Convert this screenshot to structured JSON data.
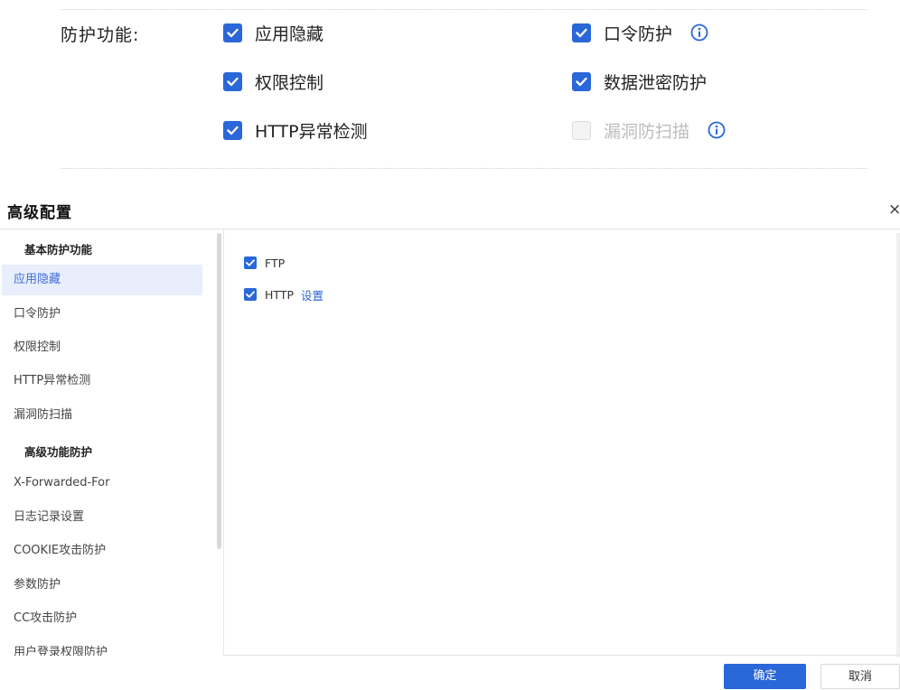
{
  "protection": {
    "label": "防护功能:",
    "options": [
      {
        "label": "应用隐藏",
        "checked": true
      },
      {
        "label": "口令防护",
        "checked": true
      },
      {
        "label": "权限控制",
        "checked": true
      },
      {
        "label": "数据泄密防护",
        "checked": true
      },
      {
        "label": "HTTP异常检测",
        "checked": true
      },
      {
        "label": "漏洞防扫描",
        "checked": false
      }
    ]
  },
  "modal": {
    "title": "高级配置",
    "close_icon": "×",
    "groups": [
      {
        "title": "基本防护功能"
      },
      {
        "title": "高级功能防护"
      }
    ],
    "nav": [
      {
        "label": "应用隐藏",
        "active": true
      },
      {
        "label": "口令防护"
      },
      {
        "label": "权限控制"
      },
      {
        "label": "HTTP异常检测"
      },
      {
        "label": "漏洞防扫描"
      },
      {
        "label": "X-Forwarded-For"
      },
      {
        "label": "日志记录设置"
      },
      {
        "label": "COOKIE攻击防护"
      },
      {
        "label": "参数防护"
      },
      {
        "label": "CC攻击防护"
      },
      {
        "label": "用户登录权限防护"
      }
    ],
    "pane": {
      "ftp_label": "FTP",
      "http_label": "HTTP",
      "http_settings_link": "设置"
    },
    "footer": {
      "confirm": "确定",
      "cancel": "取消"
    }
  },
  "colors": {
    "accent": "#2a67d8",
    "active_bg": "#e8eefb"
  }
}
